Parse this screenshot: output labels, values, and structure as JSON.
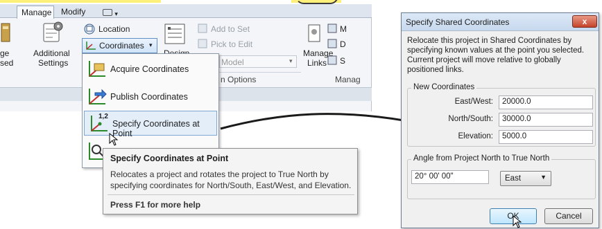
{
  "ribbon": {
    "tabs": [
      "Manage",
      "Modify"
    ],
    "left_fragments": {
      "line1": "ge",
      "line2": "sed"
    },
    "additional_settings": {
      "line1": "Additional",
      "line2": "Settings"
    },
    "location_label": "Location",
    "coordinates_label": "Coordinates",
    "design_label": "Design",
    "add_to_set": "Add to Set",
    "pick_to_edit": "Pick to Edit",
    "model_label": "Model",
    "options_label": "n Options",
    "manage_links": {
      "line1": "Manage",
      "line2": "Links"
    },
    "manage_panel": "Manag",
    "right_letters": [
      "M",
      "D",
      "S"
    ]
  },
  "menu": {
    "items": [
      {
        "label": "Acquire Coordinates"
      },
      {
        "label": "Publish Coordinates"
      },
      {
        "label": "Specify Coordinates at Point",
        "badge": "1,2"
      }
    ]
  },
  "tooltip": {
    "title": "Specify Coordinates at Point",
    "body": "Relocates a project and rotates the project to True North by specifying coordinates for North/South, East/West, and Elevation.",
    "help": "Press F1 for more help"
  },
  "dialog": {
    "title": "Specify Shared Coordinates",
    "close": "x",
    "description": "Relocate this project in Shared Coordinates by specifying known values at the point you selected. Current project will move relative to globally positioned links.",
    "new_coordinates": {
      "title": "New Coordinates",
      "fields": [
        {
          "label": "East/West:",
          "value": "20000.0"
        },
        {
          "label": "North/South:",
          "value": "30000.0"
        },
        {
          "label": "Elevation:",
          "value": "5000.0"
        }
      ]
    },
    "angle": {
      "title": "Angle from Project North to True North",
      "value": "20° 00' 00\"",
      "direction": "East"
    },
    "ok": "OK",
    "cancel": "Cancel"
  },
  "colors": {
    "highlight": "#fff07a",
    "accent": "#3c7fb1"
  }
}
